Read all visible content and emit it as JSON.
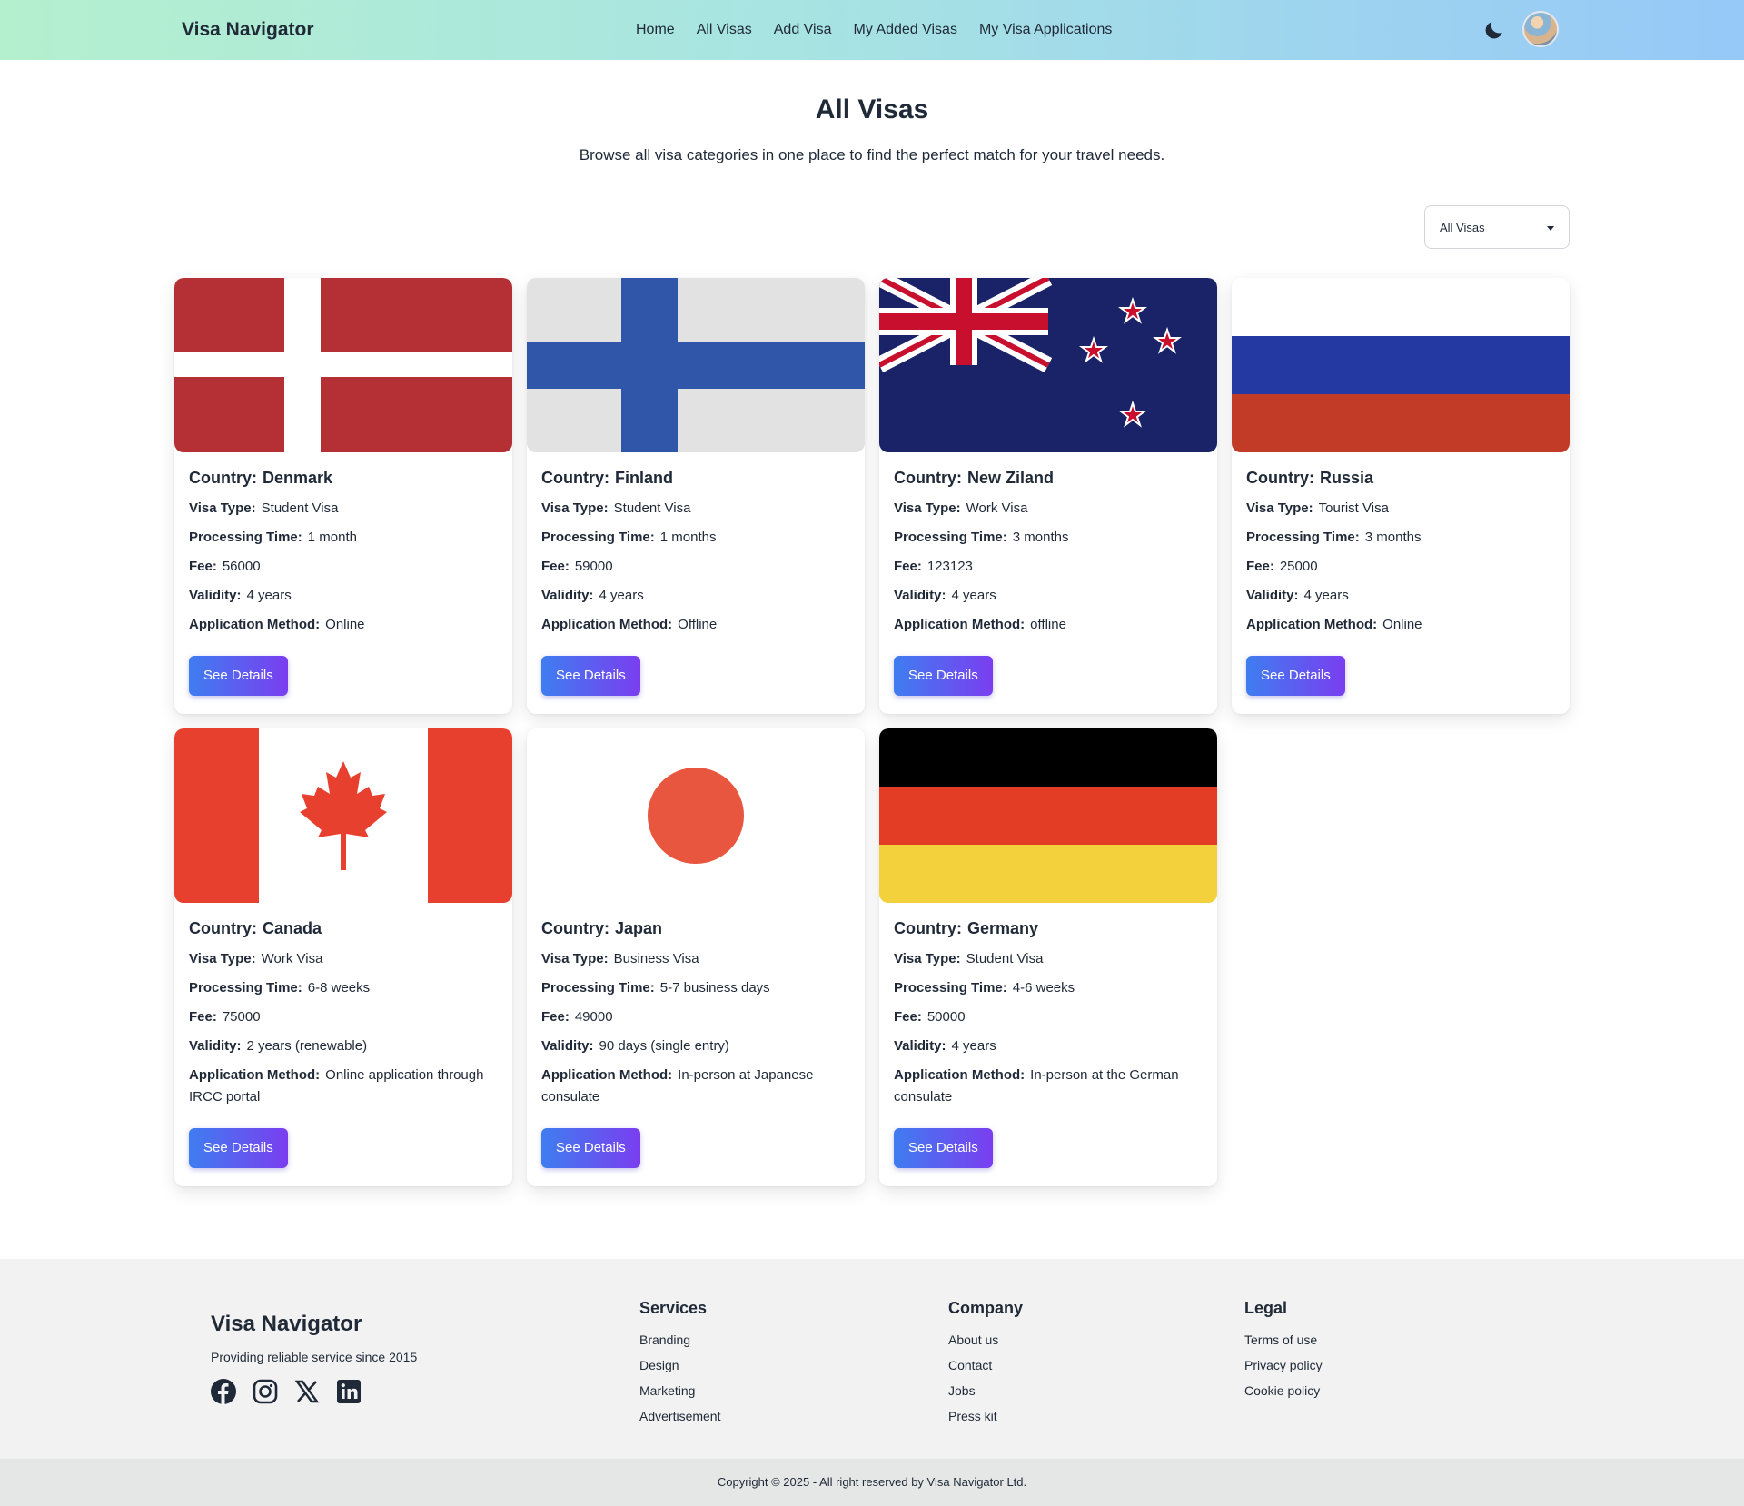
{
  "nav": {
    "brand": "Visa Navigator",
    "links": [
      "Home",
      "All Visas",
      "Add Visa",
      "My Added Visas",
      "My Visa Applications"
    ]
  },
  "header": {
    "title": "All Visas",
    "subtitle": "Browse all visa categories in one place to find the perfect match for your travel needs."
  },
  "filter": {
    "selected": "All Visas"
  },
  "labels": {
    "country": "Country:",
    "visa_type": "Visa Type:",
    "processing_time": "Processing Time:",
    "fee": "Fee:",
    "validity": "Validity:",
    "application_method": "Application Method:",
    "button": "See Details"
  },
  "visas": [
    {
      "country": "Denmark",
      "visa_type": "Student Visa",
      "processing_time": "1 month",
      "fee": "56000",
      "validity": "4 years",
      "application_method": "Online",
      "flag": "denmark-flag"
    },
    {
      "country": "Finland",
      "visa_type": "Student Visa",
      "processing_time": "1 months",
      "fee": "59000",
      "validity": "4 years",
      "application_method": "Offline",
      "flag": "finland-flag"
    },
    {
      "country": "New Ziland",
      "visa_type": "Work Visa",
      "processing_time": "3 months",
      "fee": "123123",
      "validity": "4 years",
      "application_method": "offline",
      "flag": "new-zealand-flag"
    },
    {
      "country": "Russia",
      "visa_type": "Tourist Visa",
      "processing_time": "3 months",
      "fee": "25000",
      "validity": "4 years",
      "application_method": "Online",
      "flag": "russia-flag"
    },
    {
      "country": "Canada",
      "visa_type": "Work Visa",
      "processing_time": "6-8 weeks",
      "fee": "75000",
      "validity": "2 years (renewable)",
      "application_method": "Online application through IRCC portal",
      "flag": "canada-flag"
    },
    {
      "country": "Japan",
      "visa_type": "Business Visa",
      "processing_time": "5-7 business days",
      "fee": "49000",
      "validity": "90 days (single entry)",
      "application_method": "In-person at Japanese consulate",
      "flag": "japan-flag"
    },
    {
      "country": "Germany",
      "visa_type": "Student Visa",
      "processing_time": "4-6 weeks",
      "fee": "50000",
      "validity": "4 years",
      "application_method": "In-person at the German consulate",
      "flag": "germany-flag"
    }
  ],
  "footer": {
    "brand": "Visa Navigator",
    "tagline": "Providing reliable service since 2015",
    "social_icons": [
      "facebook-icon",
      "instagram-icon",
      "x-icon",
      "linkedin-icon"
    ],
    "columns": [
      {
        "title": "Services",
        "links": [
          "Branding",
          "Design",
          "Marketing",
          "Advertisement"
        ]
      },
      {
        "title": "Company",
        "links": [
          "About us",
          "Contact",
          "Jobs",
          "Press kit"
        ]
      },
      {
        "title": "Legal",
        "links": [
          "Terms of use",
          "Privacy policy",
          "Cookie policy"
        ]
      }
    ],
    "copyright": "Copyright © 2025 - All right reserved by Visa Navigator Ltd."
  }
}
